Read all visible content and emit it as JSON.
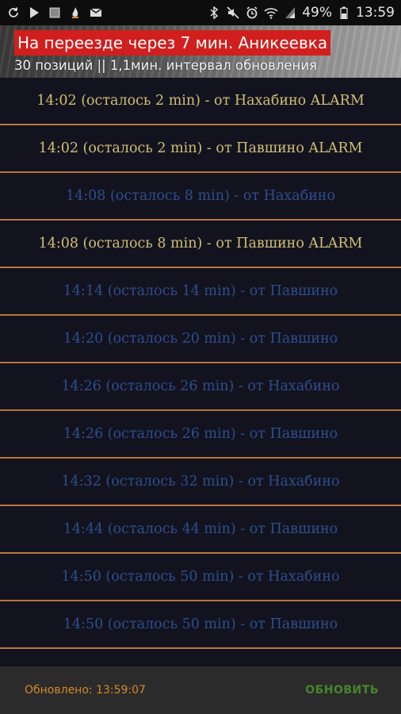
{
  "status_bar": {
    "battery": "49%",
    "time": "13:59",
    "left_icons": [
      "sync-icon",
      "play-icon",
      "square-icon",
      "fire-icon",
      "mail-icon"
    ],
    "right_icons": [
      "bluetooth-icon",
      "mute-icon",
      "alarm-icon",
      "wifi-icon",
      "signal-icon",
      "battery-icon"
    ]
  },
  "header": {
    "title": "На переезде через 7 мин. Аникеевка",
    "subtitle": "30 позиций || 1,1мин. интервал обновления",
    "title_bg_color": "#d11f1f"
  },
  "schedule": [
    {
      "text": "14:02 (осталось 2 min) - от Нахабино ALARM",
      "alarm": true
    },
    {
      "text": "14:02 (осталось 2 min) - от Павшино ALARM",
      "alarm": true
    },
    {
      "text": "14:08 (осталось 8 min) - от Нахабино",
      "alarm": false
    },
    {
      "text": "14:08 (осталось 8 min) - от Павшино ALARM",
      "alarm": true
    },
    {
      "text": "14:14 (осталось 14 min) - от Павшино",
      "alarm": false
    },
    {
      "text": "14:20 (осталось 20 min) - от Павшино",
      "alarm": false
    },
    {
      "text": "14:26 (осталось 26 min) - от Нахабино",
      "alarm": false
    },
    {
      "text": "14:26 (осталось 26 min) - от Павшино",
      "alarm": false
    },
    {
      "text": "14:32 (осталось 32 min) - от Нахабино",
      "alarm": false
    },
    {
      "text": "14:44 (осталось 44 min) - от Павшино",
      "alarm": false
    },
    {
      "text": "14:50 (осталось 50 min) - от Нахабино",
      "alarm": false
    },
    {
      "text": "14:50 (осталось 50 min) - от Павшино",
      "alarm": false
    },
    {
      "text": "",
      "alarm": false
    }
  ],
  "colors": {
    "alarm_text": "#cfbf72",
    "normal_text": "#2d4e8c",
    "divider": "#b8763f",
    "background": "#13131f"
  },
  "footer": {
    "updated_label": "Обновлено: 13:59:07",
    "refresh_label": "ОБНОВИТЬ"
  }
}
